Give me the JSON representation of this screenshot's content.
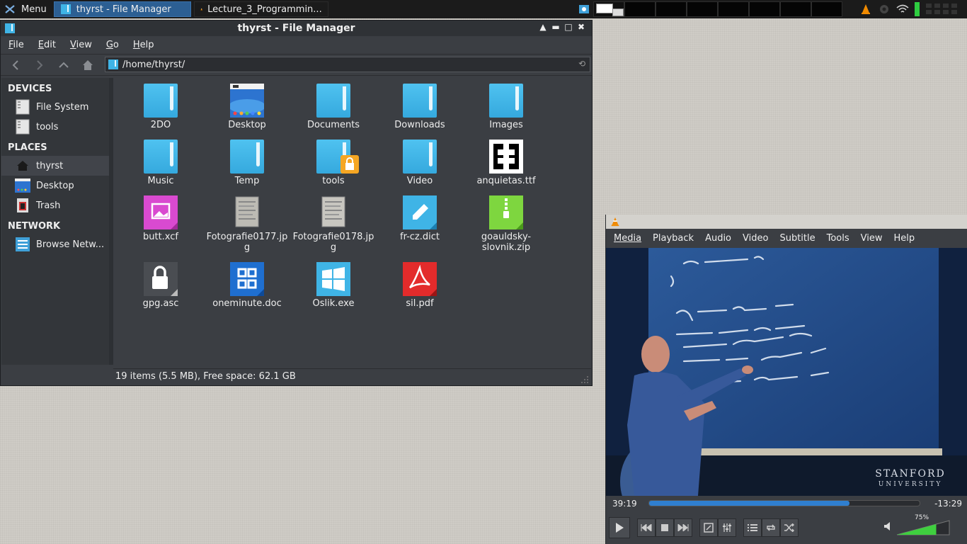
{
  "panel": {
    "menu_label": "Menu",
    "tasks": [
      {
        "label": "thyrst - File Manager"
      },
      {
        "label": "Lecture_3_Programmin..."
      }
    ]
  },
  "fm": {
    "title": "thyrst - File Manager",
    "menu": [
      {
        "label": "File",
        "accel": "F",
        "rest": "ile"
      },
      {
        "label": "Edit",
        "accel": "E",
        "rest": "dit"
      },
      {
        "label": "View",
        "accel": "V",
        "rest": "iew"
      },
      {
        "label": "Go",
        "accel": "G",
        "rest": "o"
      },
      {
        "label": "Help",
        "accel": "H",
        "rest": "elp"
      }
    ],
    "location": "/home/thyrst/",
    "sidebar": {
      "devices_header": "DEVICES",
      "devices": [
        "File System",
        "tools"
      ],
      "places_header": "PLACES",
      "places": [
        "thyrst",
        "Desktop",
        "Trash"
      ],
      "network_header": "NETWORK",
      "network": [
        "Browse Netw..."
      ]
    },
    "files": [
      {
        "name": "2DO",
        "type": "folder"
      },
      {
        "name": "Desktop",
        "type": "desktop"
      },
      {
        "name": "Documents",
        "type": "folder"
      },
      {
        "name": "Downloads",
        "type": "folder"
      },
      {
        "name": "Images",
        "type": "folder"
      },
      {
        "name": "Music",
        "type": "folder"
      },
      {
        "name": "Temp",
        "type": "folder"
      },
      {
        "name": "tools",
        "type": "folder-locked"
      },
      {
        "name": "Video",
        "type": "folder"
      },
      {
        "name": "anquietas.ttf",
        "type": "font"
      },
      {
        "name": "butt.xcf",
        "type": "xcf"
      },
      {
        "name": "Fotografie0177.jpg",
        "line1": "Fotografie0177.jp",
        "line2": "g",
        "type": "photo"
      },
      {
        "name": "Fotografie0178.jpg",
        "line1": "Fotografie0178.jp",
        "line2": "g",
        "type": "photo"
      },
      {
        "name": "fr-cz.dict",
        "type": "dict"
      },
      {
        "name": "goauldsky-slovnik.zip",
        "line1": "goauldsky-",
        "line2": "slovnik.zip",
        "type": "zip"
      },
      {
        "name": "gpg.asc",
        "type": "asc"
      },
      {
        "name": "oneminute.doc",
        "type": "doc"
      },
      {
        "name": "Oslik.exe",
        "type": "exe"
      },
      {
        "name": "sil.pdf",
        "type": "pdf"
      }
    ],
    "status": "19 items (5.5 MB), Free space: 62.1 GB"
  },
  "vlc": {
    "menu": [
      "Media",
      "Playback",
      "Audio",
      "Video",
      "Subtitle",
      "Tools",
      "View",
      "Help"
    ],
    "elapsed": "39:19",
    "remaining": "-13:29",
    "progress": 0.74,
    "volume_label": "75%",
    "volume": 0.75,
    "watermark_1": "STANFORD",
    "watermark_2": "UNIVERSITY"
  },
  "colors": {
    "accent": "#2c5f93",
    "folder": "#3fb4e6",
    "seek_fill": "#2f7fd0",
    "volume_fill": "#3fcf3f"
  }
}
